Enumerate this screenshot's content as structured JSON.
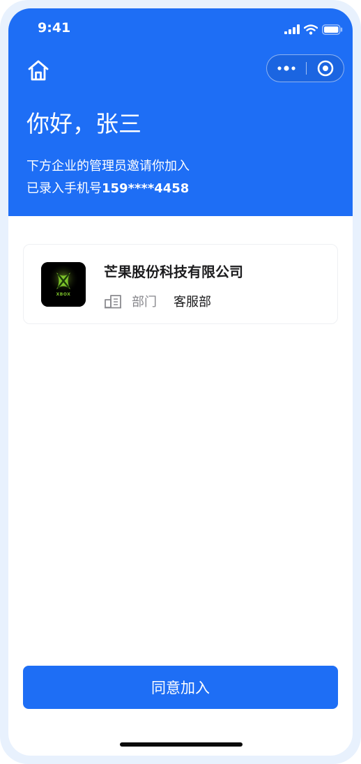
{
  "status_bar": {
    "time": "9:41",
    "icons": [
      "signal-icon",
      "wifi-icon",
      "battery-icon"
    ]
  },
  "nav": {
    "icons": [
      "home-icon",
      "more-dots-icon",
      "close-circle-icon"
    ]
  },
  "header": {
    "greeting": "你好，张三",
    "invite_text": "下方企业的管理员邀请你加入",
    "phone_prefix": "已录入手机号",
    "phone_number": "159****4458"
  },
  "company": {
    "name": "芒果股份科技有限公司",
    "logo_text": "XBOX",
    "dept_icon": "department-icon",
    "dept_label": "部门",
    "dept_value": "客服部"
  },
  "actions": {
    "agree_label": "同意加入"
  },
  "colors": {
    "primary": "#1e6ef5",
    "frame": "#e8f1fd",
    "text_primary": "#1c1c1e",
    "text_secondary": "#86868b"
  }
}
